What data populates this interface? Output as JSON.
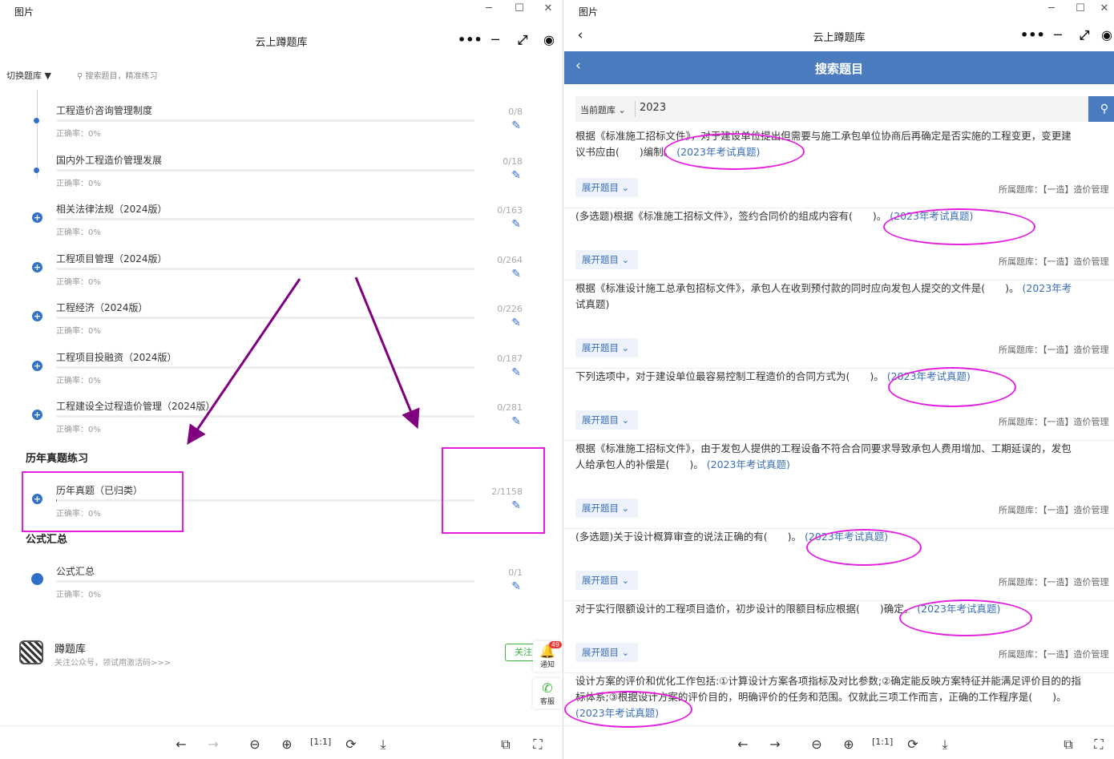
{
  "left": {
    "window_title": "图片",
    "app_title": "云上蹲题库",
    "switch_label": "切换题库",
    "search_placeholder": "搜索题目，精准练习",
    "items": [
      {
        "name": "工程造价咨询管理制度",
        "accuracy": "正确率：0%",
        "count": "0/8",
        "progress": 0
      },
      {
        "name": "国内外工程造价管理发展",
        "accuracy": "正确率：0%",
        "count": "0/18",
        "progress": 0
      },
      {
        "name": "相关法律法规（2024版）",
        "accuracy": "正确率：0%",
        "count": "0/163",
        "progress": 0
      },
      {
        "name": "工程项目管理（2024版）",
        "accuracy": "正确率：0%",
        "count": "0/264",
        "progress": 0
      },
      {
        "name": "工程经济（2024版）",
        "accuracy": "正确率：0%",
        "count": "0/226",
        "progress": 0
      },
      {
        "name": "工程项目投融资（2024版）",
        "accuracy": "正确率：0%",
        "count": "0/187",
        "progress": 0
      },
      {
        "name": "工程建设全过程造价管理（2024版）",
        "accuracy": "正确率：0%",
        "count": "0/281",
        "progress": 0
      }
    ],
    "section_past": "历年真题练习",
    "past_item": {
      "name": "历年真题（已归类）",
      "accuracy": "正确率：0%",
      "count": "2/1158",
      "progress": 0.002
    },
    "section_formula": "公式汇总",
    "formula_item": {
      "name": "公式汇总",
      "accuracy": "正确率：0%",
      "count": "0/1",
      "progress": 0
    },
    "follow": {
      "name": "蹲题库",
      "desc": "关注公众号，领试用激活码>>>",
      "button": "关注"
    },
    "notify_label": "通知",
    "notify_badge": "49",
    "service_label": "客服"
  },
  "right": {
    "window_title": "图片",
    "app_title": "云上蹲题库",
    "page_title": "搜索题目",
    "current_lib": "当前题库",
    "query": "2023",
    "expand_label": "展开题目",
    "lib_label": "所属题库：【一造】造价管理",
    "questions": [
      {
        "l1": "根据《标准施工招标文件》，对于建设单位提出但需要与施工承包单位协商后再确定是否实施的工程变更，变更建",
        "l2a": "议书应由(　　)编制。",
        "tag": "(2023年考试真题)"
      },
      {
        "l1a": "(多选题)根据《标准施工招标文件》，签约合同价的组成内容有(　　)。",
        "tag": "(2023年考试真题)"
      },
      {
        "l1a": "根据《标准设计施工总承包招标文件》，承包人在收到预付款的同时应向发包人提交的文件是(　　)。",
        "tag": "(2023年考",
        "l2": "试真题)"
      },
      {
        "l1a": "下列选项中，对于建设单位最容易控制工程造价的合同方式为(　　)。",
        "tag": "(2023年考试真题)"
      },
      {
        "l1": "根据《标准施工招标文件》，由于发包人提供的工程设备不符合合同要求导致承包人费用增加、工期延误的，发包",
        "l2a": "人给承包人的补偿是(　　)。",
        "tag": "(2023年考试真题)"
      },
      {
        "l1a": "(多选题)关于设计概算审查的说法正确的有(　　)。",
        "tag": "(2023年考试真题)"
      },
      {
        "l1a": "对于实行限额设计的工程项目造价，初步设计的限额目标应根据(　　)确定。",
        "tag": "(2023年考试真题)"
      },
      {
        "l1": "设计方案的评价和优化工作包括:①计算设计方案各项指标及对比参数;②确定能反映方案特征并能满足评价目的的指",
        "l2": "标体系;③根据设计方案的评价目的，明确评价的任务和范围。仅就此三项工作而言，正确的工作程序是(　　)。",
        "tag3": "(2023年考试真题)"
      }
    ]
  },
  "viewer": {
    "icons": [
      "arrow-left",
      "arrow-right",
      "zoom-out",
      "zoom-in",
      "actual-size",
      "rotate",
      "download",
      "ocr",
      "scan"
    ]
  }
}
